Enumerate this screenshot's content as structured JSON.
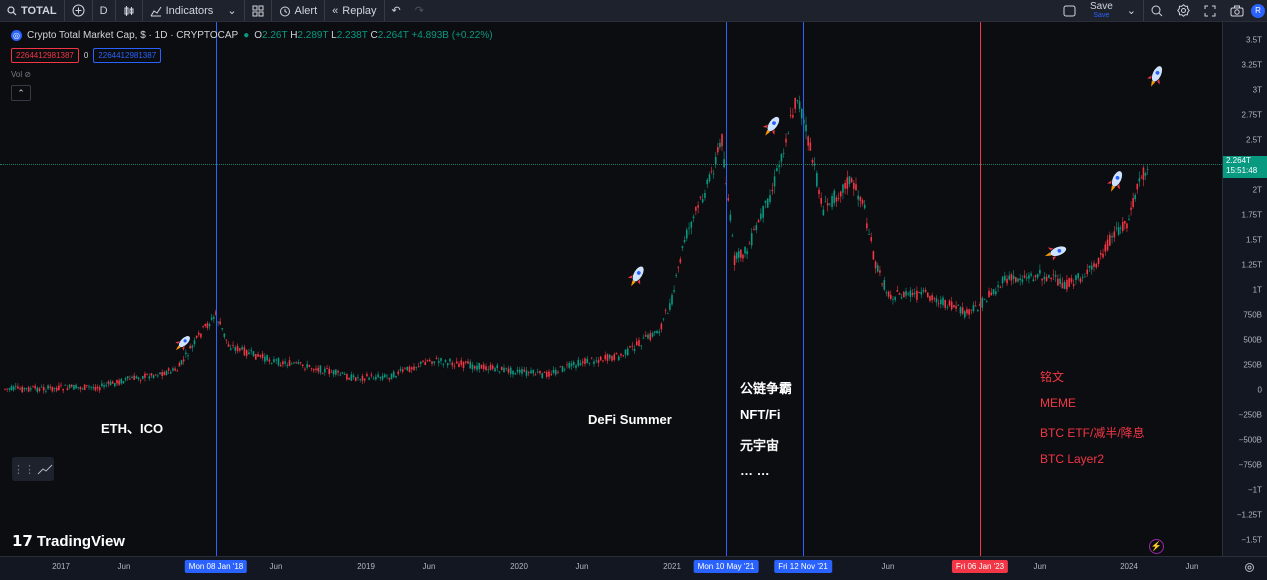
{
  "toolbar": {
    "symbol": "TOTAL",
    "interval": "D",
    "indicators": "Indicators",
    "alert": "Alert",
    "replay": "Replay",
    "save": "Save",
    "save_sub": "Save",
    "avatar": "R"
  },
  "legend": {
    "title": "Crypto Total Market Cap, $ · 1D · CRYPTOCAP",
    "o_label": "O",
    "o": "2.26T",
    "h_label": "H",
    "h": "2.289T",
    "l_label": "L",
    "l": "2.238T",
    "c_label": "C",
    "c": "2.264T",
    "change": "+4.893B (+0.22%)",
    "box_red": "2264412981387",
    "box_mid": "0",
    "box_blue": "2264412981387",
    "vol": "Vol"
  },
  "price_tag": {
    "value": "2.264T",
    "countdown": "15:51:48"
  },
  "annotations": {
    "eth": "ETH、ICO",
    "defi": "DeFi Summer",
    "line1": "公链争霸",
    "line2": "NFT/Fi",
    "line3": "元宇宙",
    "line4": "… …",
    "red1": "铭文",
    "red2": "MEME",
    "red3": "BTC ETF/减半/降息",
    "red4": "BTC Layer2"
  },
  "branding": "TradingView",
  "colors": {
    "up": "#089981",
    "down": "#f23645",
    "blue": "#2962ff",
    "bg": "#0c0d10"
  },
  "chart_data": {
    "type": "line",
    "title": "Crypto Total Market Cap, $ · 1D · CRYPTOCAP",
    "y_unit": "USD",
    "yticks": [
      "3.5T",
      "3.25T",
      "3T",
      "2.75T",
      "2.5T",
      "2.25T",
      "2T",
      "1.75T",
      "1.5T",
      "1.25T",
      "1T",
      "750B",
      "500B",
      "250B",
      "0",
      "−250B",
      "−500B",
      "−750B",
      "−1T",
      "−1.25T",
      "−1.5T"
    ],
    "ylim": [
      -1.5,
      3.5
    ],
    "xticks": [
      "2017",
      "Jun",
      "Mon 08 Jan '18",
      "Jun",
      "2019",
      "Jun",
      "2020",
      "Jun",
      "2021",
      "Mon 10 May '21",
      "Fri 12 Nov '21",
      "Jun",
      "Fri 06 Jan '23",
      "Jun",
      "2024",
      "Jun"
    ],
    "highlighted_dates": [
      {
        "label": "Mon 08 Jan '18",
        "color": "#2962ff"
      },
      {
        "label": "Mon 10 May '21",
        "color": "#2962ff"
      },
      {
        "label": "Fri 12 Nov '21",
        "color": "#2962ff"
      },
      {
        "label": "Fri 06 Jan '23",
        "color": "#f23645"
      }
    ],
    "series": [
      {
        "x": [
          "2016-07",
          "2016-10",
          "2017-01",
          "2017-04",
          "2017-06",
          "2017-08",
          "2017-10",
          "2017-12",
          "2018-01",
          "2018-02",
          "2018-04",
          "2018-06",
          "2018-09",
          "2018-12",
          "2019-03",
          "2019-06",
          "2019-09",
          "2019-12",
          "2020-03",
          "2020-06",
          "2020-09",
          "2020-12",
          "2021-01",
          "2021-02",
          "2021-04",
          "2021-05",
          "2021-06",
          "2021-07",
          "2021-09",
          "2021-11",
          "2021-12",
          "2022-01",
          "2022-03",
          "2022-04",
          "2022-05",
          "2022-06",
          "2022-09",
          "2022-12",
          "2023-01",
          "2023-03",
          "2023-06",
          "2023-08",
          "2023-10",
          "2023-12",
          "2024-01",
          "2024-02",
          "2024-03"
        ],
        "values": [
          0.01,
          0.01,
          0.02,
          0.03,
          0.1,
          0.15,
          0.2,
          0.6,
          0.75,
          0.45,
          0.35,
          0.28,
          0.22,
          0.12,
          0.14,
          0.3,
          0.25,
          0.2,
          0.15,
          0.28,
          0.34,
          0.6,
          0.9,
          1.5,
          2.1,
          2.5,
          1.3,
          1.4,
          2.0,
          2.95,
          2.4,
          1.8,
          2.1,
          1.9,
          1.25,
          0.95,
          0.95,
          0.76,
          0.85,
          1.1,
          1.15,
          1.05,
          1.2,
          1.6,
          1.7,
          2.1,
          2.264
        ]
      }
    ]
  }
}
